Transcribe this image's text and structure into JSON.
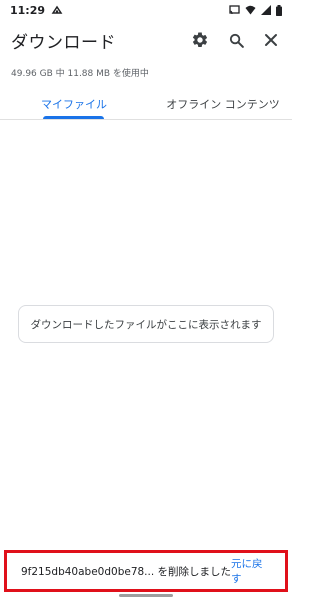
{
  "status_bar": {
    "time": "11:29",
    "icons": [
      "cloud-sync-icon",
      "cast-icon",
      "wifi-icon",
      "signal-icon",
      "battery-icon"
    ]
  },
  "app_bar": {
    "title": "ダウンロード",
    "actions": [
      "settings-icon",
      "search-icon",
      "close-icon"
    ]
  },
  "storage_info": "49.96 GB 中 11.88 MB を使用中",
  "tabs": [
    {
      "label": "マイファイル",
      "active": true
    },
    {
      "label": "オフライン コンテンツ",
      "active": false
    }
  ],
  "empty_state": {
    "message": "ダウンロードしたファイルがここに表示されます"
  },
  "snackbar": {
    "message": "9f215db40abe0d0be78... を削除しました",
    "action_label": "元に戻す"
  },
  "colors": {
    "accent": "#1a73e8",
    "highlight_border": "#e0101a"
  }
}
